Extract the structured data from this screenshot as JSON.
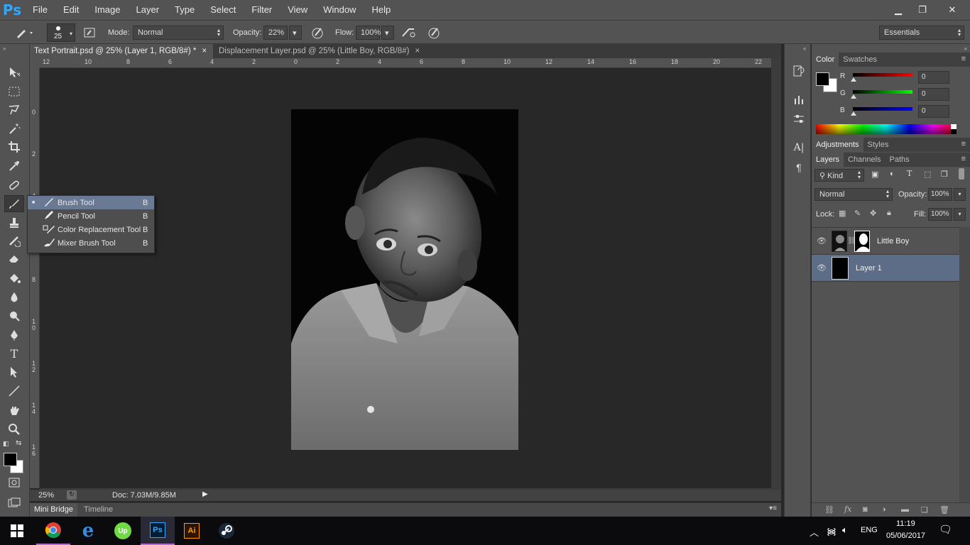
{
  "app": {
    "logo": "Ps"
  },
  "menu": [
    "File",
    "Edit",
    "Image",
    "Layer",
    "Type",
    "Select",
    "Filter",
    "View",
    "Window",
    "Help"
  ],
  "options": {
    "brush_size": "25",
    "mode_label": "Mode:",
    "mode_value": "Normal",
    "opacity_label": "Opacity:",
    "opacity_value": "22%",
    "flow_label": "Flow:",
    "flow_value": "100%",
    "workspace": "Essentials"
  },
  "tabs": [
    {
      "label": "Text Portrait.psd @ 25% (Layer 1, RGB/8#) *",
      "close": "×",
      "active": true
    },
    {
      "label": "Displacement Layer.psd @ 25% (Little Boy, RGB/8#)",
      "close": "×",
      "active": false
    }
  ],
  "ruler_top": [
    "12",
    "10",
    "8",
    "6",
    "4",
    "2",
    "0",
    "2",
    "4",
    "6",
    "8",
    "10",
    "12",
    "14",
    "16",
    "18",
    "20",
    "22"
  ],
  "ruler_left": [
    "0",
    "2",
    "4",
    "6",
    "8",
    "1\n0",
    "1\n2",
    "1\n4",
    "1\n6"
  ],
  "flyout": [
    {
      "bullet": "■",
      "label": "Brush Tool",
      "key": "B",
      "selected": true,
      "icon": "brush-icon"
    },
    {
      "bullet": "",
      "label": "Pencil Tool",
      "key": "B",
      "selected": false,
      "icon": "pencil-icon"
    },
    {
      "bullet": "",
      "label": "Color Replacement Tool",
      "key": "B",
      "selected": false,
      "icon": "color-replacement-icon"
    },
    {
      "bullet": "",
      "label": "Mixer Brush Tool",
      "key": "B",
      "selected": false,
      "icon": "mixer-brush-icon"
    }
  ],
  "status": {
    "zoom": "25%",
    "doc": "Doc: 7.03M/9.85M"
  },
  "bottom_tabs": [
    "Mini Bridge",
    "Timeline"
  ],
  "color_panel": {
    "tabs": [
      "Color",
      "Swatches"
    ],
    "channels": [
      {
        "label": "R",
        "value": "0",
        "color": "#ff0000"
      },
      {
        "label": "G",
        "value": "0",
        "color": "#00ff00"
      },
      {
        "label": "B",
        "value": "0",
        "color": "#0000ff"
      }
    ]
  },
  "adjust_tabs": [
    "Adjustments",
    "Styles"
  ],
  "layers_panel": {
    "tabs": [
      "Layers",
      "Channels",
      "Paths"
    ],
    "filter_kind": "Kind",
    "blend_mode": "Normal",
    "opacity_label": "Opacity:",
    "opacity_value": "100%",
    "lock_label": "Lock:",
    "fill_label": "Fill:",
    "fill_value": "100%",
    "layers": [
      {
        "name": "Little Boy",
        "selected": false
      },
      {
        "name": "Layer 1",
        "selected": true
      }
    ]
  },
  "taskbar": {
    "language": "ENG",
    "time": "11:19",
    "date": "05/06/2017",
    "apps": [
      "windows-start",
      "chrome",
      "internet-explorer",
      "upwork",
      "photoshop",
      "illustrator",
      "steam"
    ]
  },
  "colors": {
    "accent": "#6a7a94",
    "ps_blue": "#31a8ff"
  }
}
